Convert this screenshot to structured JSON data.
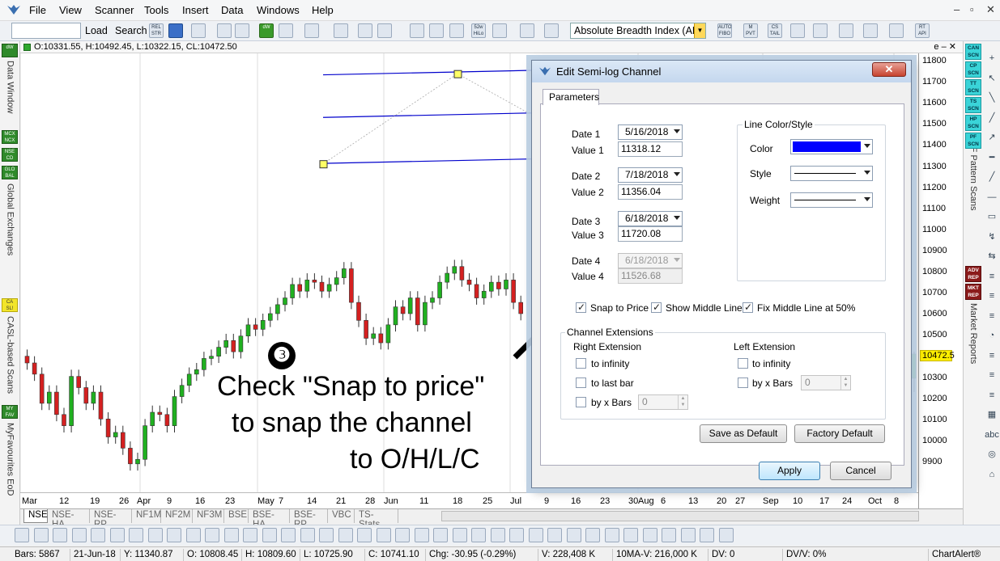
{
  "menu": {
    "items": [
      "File",
      "View",
      "Scanner",
      "Tools",
      "Insert",
      "Data",
      "Windows",
      "Help"
    ],
    "win_controls": [
      "–",
      "▫",
      "✕"
    ]
  },
  "toolbar": {
    "load_label": "Load",
    "search_label": "Search",
    "rel_str": "REL STR",
    "week52": "52w HiLo",
    "indicator_value": "Absolute Breadth Index (ABI",
    "auto_fibo": "AUTO FIBO",
    "m_pvt": "M PVT",
    "cs_tail": "CS TAIL",
    "rt_api": "RT API",
    "dw": "dW"
  },
  "left_panel": {
    "data_window": "Data Window",
    "global_exchanges": "Global Exchanges",
    "casl_scans": "CASL-based Scans",
    "myfavourites": "MyFavourites EoD",
    "badges": [
      "dW",
      "MCX NCX",
      "NSE CD",
      "GLO BAL",
      "CA SL!",
      "MY FAV"
    ]
  },
  "right_panel": {
    "pnf_scans": "P&F Pattern Scans",
    "market_reports": "Market Reports",
    "badges": [
      "CAN SCN",
      "CP SCN",
      "TT SCN",
      "TS SCN",
      "HP SCN",
      "PF SCN",
      "ADV REP",
      "MKT REP"
    ],
    "tools": [
      "+",
      "↖",
      "╲",
      "╱",
      "↗",
      "━",
      "╱",
      "—",
      "▭",
      "↯",
      "⇆",
      "≡",
      "≡",
      "≡",
      "◔",
      "≡",
      "≡",
      "≡",
      "▦",
      "abc",
      "◎",
      "⌂"
    ]
  },
  "chart": {
    "ohlc": "O:10331.55, H:10492.45, L:10322.15, CL:10472.50",
    "header_ctrl": "e – ✕",
    "price_labels": [
      "11800",
      "11700",
      "11600",
      "11500",
      "11400",
      "11300",
      "11200",
      "11100",
      "11000",
      "10900",
      "10800",
      "10700",
      "10600",
      "10500",
      "10400",
      "10300",
      "10200",
      "10100",
      "10000",
      "9900"
    ],
    "current_price": "10472.5",
    "date_labels": [
      "Mar",
      "12",
      "19",
      "26",
      "Apr",
      "9",
      "16",
      "23",
      "May",
      "7",
      "14",
      "21",
      "28",
      "Jun",
      "11",
      "18",
      "25",
      "Jul",
      "9",
      "16",
      "23",
      "30",
      "Aug",
      "6",
      "13",
      "20",
      "27",
      "Sep",
      "10",
      "17",
      "24",
      "Oct",
      "8"
    ]
  },
  "annotation": {
    "number": "❸",
    "line1": "Check \"Snap to price\"",
    "line2": "to snap the channel",
    "line3": "to O/H/L/C"
  },
  "sheet_tabs": [
    "NSE",
    "NSE-HA",
    "NSE-RP",
    "NF1M",
    "NF2M",
    "NF3M",
    "BSE",
    "BSE-HA",
    "BSE-RP",
    "VBC",
    "TS-Stats"
  ],
  "dialog": {
    "title": "Edit Semi-log Channel",
    "tab_parameters": "Parameters",
    "date1_label": "Date 1",
    "date1": "5/16/2018",
    "value1_label": "Value 1",
    "value1": "11318.12",
    "date2_label": "Date 2",
    "date2": "7/18/2018",
    "value2_label": "Value 2",
    "value2": "11356.04",
    "date3_label": "Date 3",
    "date3": "6/18/2018",
    "value3_label": "Value 3",
    "value3": "11720.08",
    "date4_label": "Date 4",
    "date4": "6/18/2018",
    "value4_label": "Value 4",
    "value4": "11526.68",
    "line_color_style": "Line Color/Style",
    "color_label": "Color",
    "color_value": "#0000ff",
    "style_label": "Style",
    "weight_label": "Weight",
    "snap_to_price": "Snap to Price",
    "show_middle_line": "Show Middle Line",
    "fix_middle_line": "Fix Middle Line at 50%",
    "channel_extensions": "Channel Extensions",
    "right_extension": "Right Extension",
    "left_extension": "Left Extension",
    "to_infinity": "to infinity",
    "to_last_bar": "to last bar",
    "by_x_bars": "by x Bars",
    "bars_value": "0",
    "save_default": "Save as Default",
    "factory_default": "Factory Default",
    "apply": "Apply",
    "cancel": "Cancel"
  },
  "status": {
    "bars": "Bars: 5867",
    "date": "21-Jun-18",
    "y": "Y: 11340.87",
    "o": "O: 10808.45",
    "h": "H: 10809.60",
    "l": "L: 10725.90",
    "c": "C: 10741.10",
    "chg": "Chg: -30.95 (-0.29%)",
    "v": "V: 228,408 K",
    "ma": "10MA-V: 216,000 K",
    "dv": "DV: 0",
    "dvv": "DV/V: 0%",
    "brand": "ChartAlert®"
  }
}
